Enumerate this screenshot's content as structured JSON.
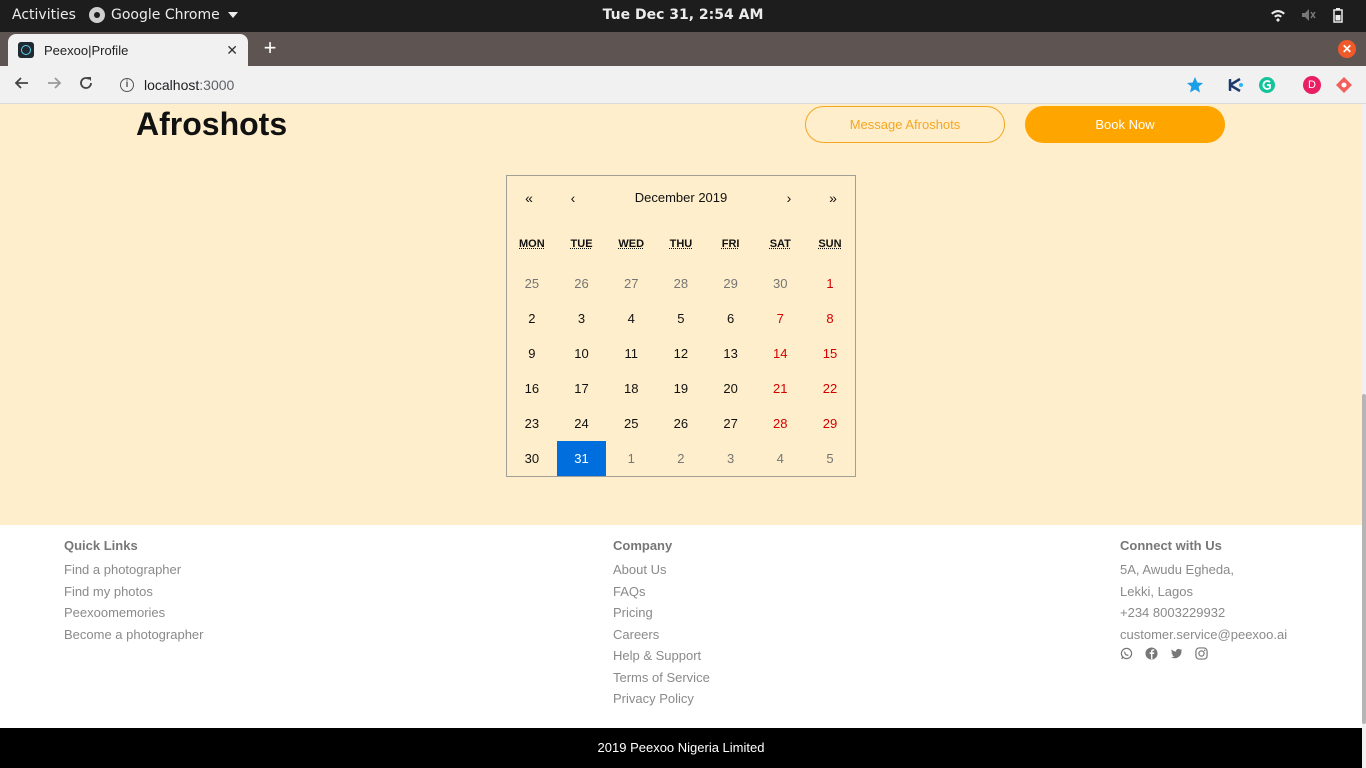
{
  "system": {
    "activities": "Activities",
    "app_name": "Google Chrome",
    "clock": "Tue Dec 31,  2:54 AM"
  },
  "browser": {
    "tab_title": "Peexoo|Profile",
    "url_host": "localhost",
    "url_port": ":3000",
    "extension_avatar": "D"
  },
  "profile": {
    "studio_name": "Afroshots",
    "message_button": "Message Afroshots",
    "book_button": "Book Now"
  },
  "calendar": {
    "prev_year": "«",
    "prev_month": "‹",
    "month_label": "December 2019",
    "next_month": "›",
    "next_year": "»",
    "weekdays": [
      "MON",
      "TUE",
      "WED",
      "THU",
      "FRI",
      "SAT",
      "SUN"
    ],
    "days": [
      {
        "d": "25",
        "t": "neighbor"
      },
      {
        "d": "26",
        "t": "neighbor"
      },
      {
        "d": "27",
        "t": "neighbor"
      },
      {
        "d": "28",
        "t": "neighbor"
      },
      {
        "d": "29",
        "t": "neighbor"
      },
      {
        "d": "30",
        "t": "neighbor"
      },
      {
        "d": "1",
        "t": "weekend"
      },
      {
        "d": "2",
        "t": ""
      },
      {
        "d": "3",
        "t": ""
      },
      {
        "d": "4",
        "t": ""
      },
      {
        "d": "5",
        "t": ""
      },
      {
        "d": "6",
        "t": ""
      },
      {
        "d": "7",
        "t": "weekend"
      },
      {
        "d": "8",
        "t": "weekend"
      },
      {
        "d": "9",
        "t": ""
      },
      {
        "d": "10",
        "t": ""
      },
      {
        "d": "11",
        "t": ""
      },
      {
        "d": "12",
        "t": ""
      },
      {
        "d": "13",
        "t": ""
      },
      {
        "d": "14",
        "t": "weekend"
      },
      {
        "d": "15",
        "t": "weekend"
      },
      {
        "d": "16",
        "t": ""
      },
      {
        "d": "17",
        "t": ""
      },
      {
        "d": "18",
        "t": ""
      },
      {
        "d": "19",
        "t": ""
      },
      {
        "d": "20",
        "t": ""
      },
      {
        "d": "21",
        "t": "weekend"
      },
      {
        "d": "22",
        "t": "weekend"
      },
      {
        "d": "23",
        "t": ""
      },
      {
        "d": "24",
        "t": ""
      },
      {
        "d": "25",
        "t": ""
      },
      {
        "d": "26",
        "t": ""
      },
      {
        "d": "27",
        "t": ""
      },
      {
        "d": "28",
        "t": "weekend"
      },
      {
        "d": "29",
        "t": "weekend"
      },
      {
        "d": "30",
        "t": ""
      },
      {
        "d": "31",
        "t": "today"
      },
      {
        "d": "1",
        "t": "neighbor"
      },
      {
        "d": "2",
        "t": "neighbor"
      },
      {
        "d": "3",
        "t": "neighbor"
      },
      {
        "d": "4",
        "t": "neighbor"
      },
      {
        "d": "5",
        "t": "neighbor"
      }
    ]
  },
  "footer": {
    "quick_links": {
      "heading": "Quick Links",
      "items": [
        "Find a photographer",
        "Find my photos",
        "Peexoomemories",
        "Become a photographer"
      ]
    },
    "company": {
      "heading": "Company",
      "items": [
        "About Us",
        "FAQs",
        "Pricing",
        "Careers",
        "Help & Support",
        "Terms of Service",
        "Privacy Policy"
      ]
    },
    "connect": {
      "heading": "Connect with Us",
      "address_line1": "5A, Awudu Egheda,",
      "address_line2": "Lekki, Lagos",
      "phone": "+234 8003229932",
      "email": "customer.service@peexoo.ai",
      "social_icons": [
        "whatsapp-icon",
        "facebook-icon",
        "twitter-icon",
        "instagram-icon"
      ]
    },
    "copyright": "2019 Peexoo Nigeria Limited"
  },
  "colors": {
    "hero_bg": "#feeecb",
    "accent": "#ffa500",
    "today": "#006edc",
    "weekend": "#d10000"
  }
}
